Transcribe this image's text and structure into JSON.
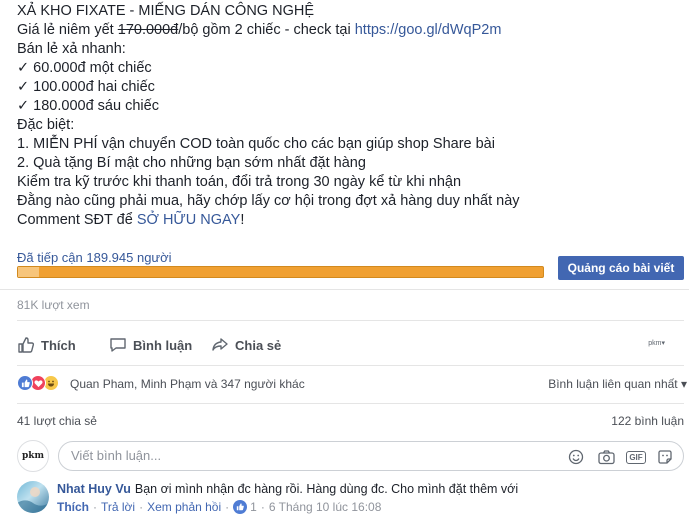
{
  "post": {
    "lines": [
      "XẢ KHO FIXATE - MIẾNG DÁN CÔNG NGHỆ",
      "Bán lẻ xả nhanh:",
      "✓ 60.000đ một chiếc",
      "✓ 100.000đ hai chiếc",
      "✓ 180.000đ sáu chiếc",
      "Đặc biệt:",
      "1. MIỄN PHÍ vận chuyển COD toàn quốc cho các bạn giúp shop Share bài",
      "2. Quà tặng Bí mật cho những bạn sớm nhất đặt hàng",
      "Kiểm tra kỹ trước khi thanh toán, đổi trả trong 30 ngày kể từ khi nhận",
      "Đằng nào cũng phải mua, hãy chớp lấy cơ hội trong đợt xả hàng duy nhất này"
    ],
    "price_line": {
      "prefix": "Giá lẻ niêm yết ",
      "struck_price": "170.000đ",
      "middle": "/bộ gồm 2 chiếc - check tại ",
      "link": "https://goo.gl/dWqP2m"
    },
    "cta_line": {
      "prefix": "Comment SĐT để ",
      "link": "SỞ HỮU NGAY",
      "suffix": "!"
    }
  },
  "reach": {
    "label": "Đã tiếp cận 189.945 người",
    "organic_fraction": 0.04,
    "promote_button": "Quảng cáo bài viết"
  },
  "views": "81K lượt xem",
  "actions": {
    "like": "Thích",
    "comment": "Bình luận",
    "share": "Chia sẻ",
    "mini_label": "pkm"
  },
  "reactions": {
    "summary": "Quan Pham, Minh Phạm và 347 người khác",
    "sort_label": "Bình luận liên quan nhất",
    "types": [
      "like",
      "love",
      "haha"
    ]
  },
  "stats": {
    "shares": "41 lượt chia sẻ",
    "comments": "122 bình luận"
  },
  "composer": {
    "avatar_text": "pkm",
    "placeholder": "Viết bình luận...",
    "gif_label": "GIF"
  },
  "comment": {
    "author": "Nhat Huy Vu",
    "text": "Bạn ơi mình nhận đc hàng rồi. Hàng dùng đc. Cho mình đặt thêm với",
    "like": "Thích",
    "reply": "Trả lời",
    "view_edits": "Xem phản hồi",
    "like_count": "1",
    "timestamp": "6 Tháng 10 lúc 16:08"
  },
  "colors": {
    "link": "#365899",
    "button": "#4267b2",
    "reach_bar": "#f0a032",
    "reach_bar_light": "#f7c57b"
  }
}
